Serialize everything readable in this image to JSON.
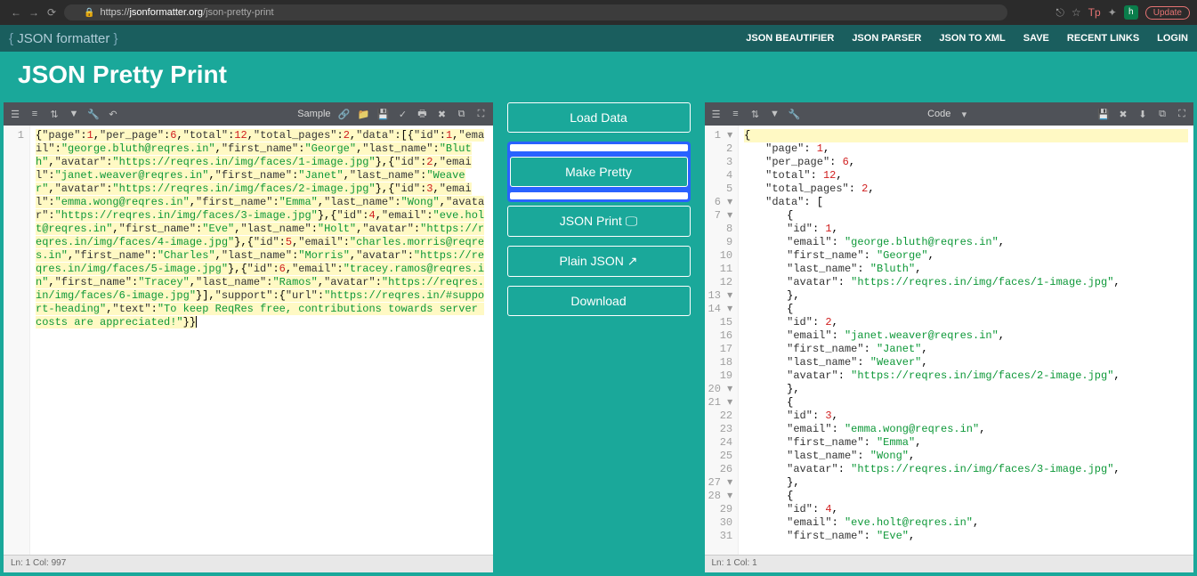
{
  "browser": {
    "url_prefix": "https://",
    "url_highlight": "jsonformatter.org",
    "url_path": "/json-pretty-print",
    "update_label": "Update"
  },
  "header": {
    "logo": "JSON formatter",
    "nav": {
      "beautifier": "JSON BEAUTIFIER",
      "parser": "JSON PARSER",
      "toxml": "JSON TO XML",
      "save": "SAVE",
      "recent": "RECENT LINKS",
      "login": "LOGIN"
    }
  },
  "page_title": "JSON Pretty Print",
  "left_toolbar": {
    "sample": "Sample"
  },
  "right_toolbar": {
    "mode": "Code"
  },
  "actions": {
    "load": "Load Data",
    "make_pretty": "Make Pretty",
    "json_print": "JSON Print 🖵",
    "plain_json": "Plain JSON ↗",
    "download": "Download"
  },
  "left_status": "Ln: 1   Col: 997",
  "right_status": "Ln: 1   Col: 1",
  "json_input_raw": "{\"page\":1,\"per_page\":6,\"total\":12,\"total_pages\":2,\"data\":[{\"id\":1,\"email\":\"george.bluth@reqres.in\",\"first_name\":\"George\",\"last_name\":\"Bluth\",\"avatar\":\"https://reqres.in/img/faces/1-image.jpg\"},{\"id\":2,\"email\":\"janet.weaver@reqres.in\",\"first_name\":\"Janet\",\"last_name\":\"Weaver\",\"avatar\":\"https://reqres.in/img/faces/2-image.jpg\"},{\"id\":3,\"email\":\"emma.wong@reqres.in\",\"first_name\":\"Emma\",\"last_name\":\"Wong\",\"avatar\":\"https://reqres.in/img/faces/3-image.jpg\"},{\"id\":4,\"email\":\"eve.holt@reqres.in\",\"first_name\":\"Eve\",\"last_name\":\"Holt\",\"avatar\":\"https://reqres.in/img/faces/4-image.jpg\"},{\"id\":5,\"email\":\"charles.morris@reqres.in\",\"first_name\":\"Charles\",\"last_name\":\"Morris\",\"avatar\":\"https://reqres.in/img/faces/5-image.jpg\"},{\"id\":6,\"email\":\"tracey.ramos@reqres.in\",\"first_name\":\"Tracey\",\"last_name\":\"Ramos\",\"avatar\":\"https://reqres.in/img/faces/6-image.jpg\"}],\"support\":{\"url\":\"https://reqres.in/#support-heading\",\"text\":\"To keep ReqRes free, contributions towards server costs are appreciated!\"}}",
  "json_output": {
    "page": 1,
    "per_page": 6,
    "total": 12,
    "total_pages": 2,
    "data": [
      {
        "id": 1,
        "email": "george.bluth@reqres.in",
        "first_name": "George",
        "last_name": "Bluth",
        "avatar": "https://reqres.in/img/faces/1-image.jpg"
      },
      {
        "id": 2,
        "email": "janet.weaver@reqres.in",
        "first_name": "Janet",
        "last_name": "Weaver",
        "avatar": "https://reqres.in/img/faces/2-image.jpg"
      },
      {
        "id": 3,
        "email": "emma.wong@reqres.in",
        "first_name": "Emma",
        "last_name": "Wong",
        "avatar": "https://reqres.in/img/faces/3-image.jpg"
      },
      {
        "id": 4,
        "email": "eve.holt@reqres.in",
        "first_name": "Eve"
      }
    ]
  },
  "right_visible_lines": 31
}
